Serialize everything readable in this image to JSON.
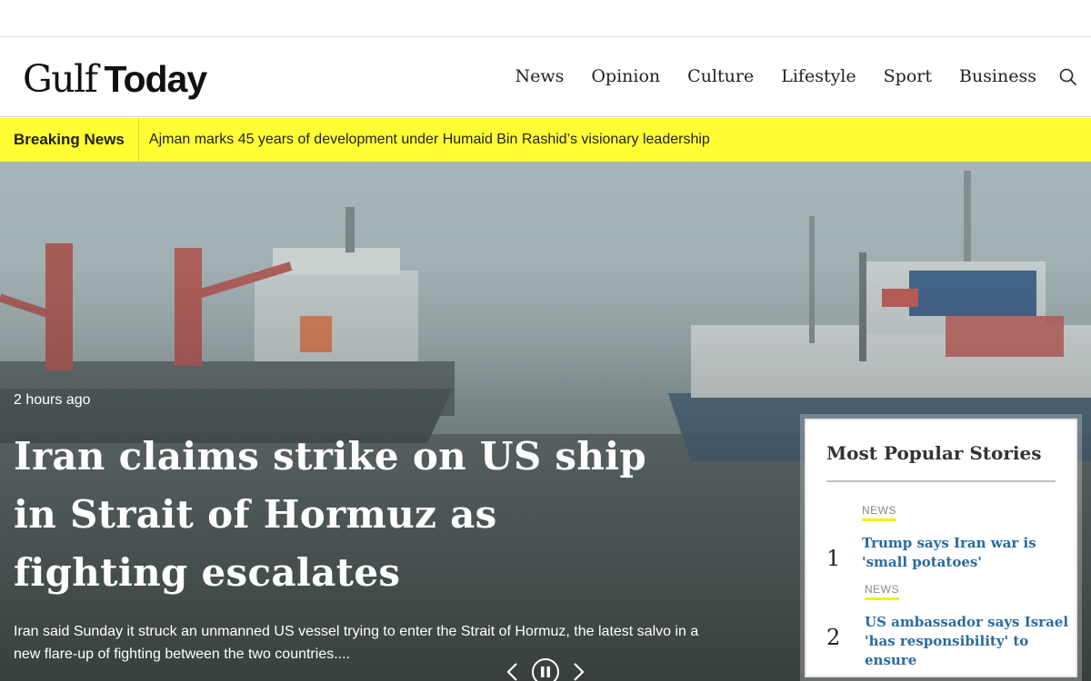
{
  "header": {
    "logo_part1": "Gulf",
    "logo_part2": "Today",
    "nav": [
      "News",
      "Opinion",
      "Culture",
      "Lifestyle",
      "Sport",
      "Business"
    ]
  },
  "breaking": {
    "label": "Breaking News",
    "text": "Ajman marks 45 years of development under Humaid Bin Rashid’s visionary leadership"
  },
  "hero": {
    "timestamp": "2 hours ago",
    "headline": "Iran claims strike on US ship in Strait of Hormuz as fighting escalates",
    "summary": "Iran said Sunday it struck an unmanned US vessel trying to enter the Strait of Hormuz, the latest salvo in a new flare-up of fighting between the two countries...."
  },
  "popular": {
    "title": "Most Popular Stories",
    "stories": [
      {
        "rank": "1",
        "tag": "NEWS",
        "title": "Trump says Iran war is 'small potatoes'"
      },
      {
        "rank": "2",
        "tag": "NEWS",
        "title": "US ambassador says Israel 'has responsibility' to ensure"
      }
    ]
  },
  "colors": {
    "breaking_bg": "#fefe33",
    "story_link": "#2a6aa1",
    "tag_underline": "#f2f200"
  }
}
